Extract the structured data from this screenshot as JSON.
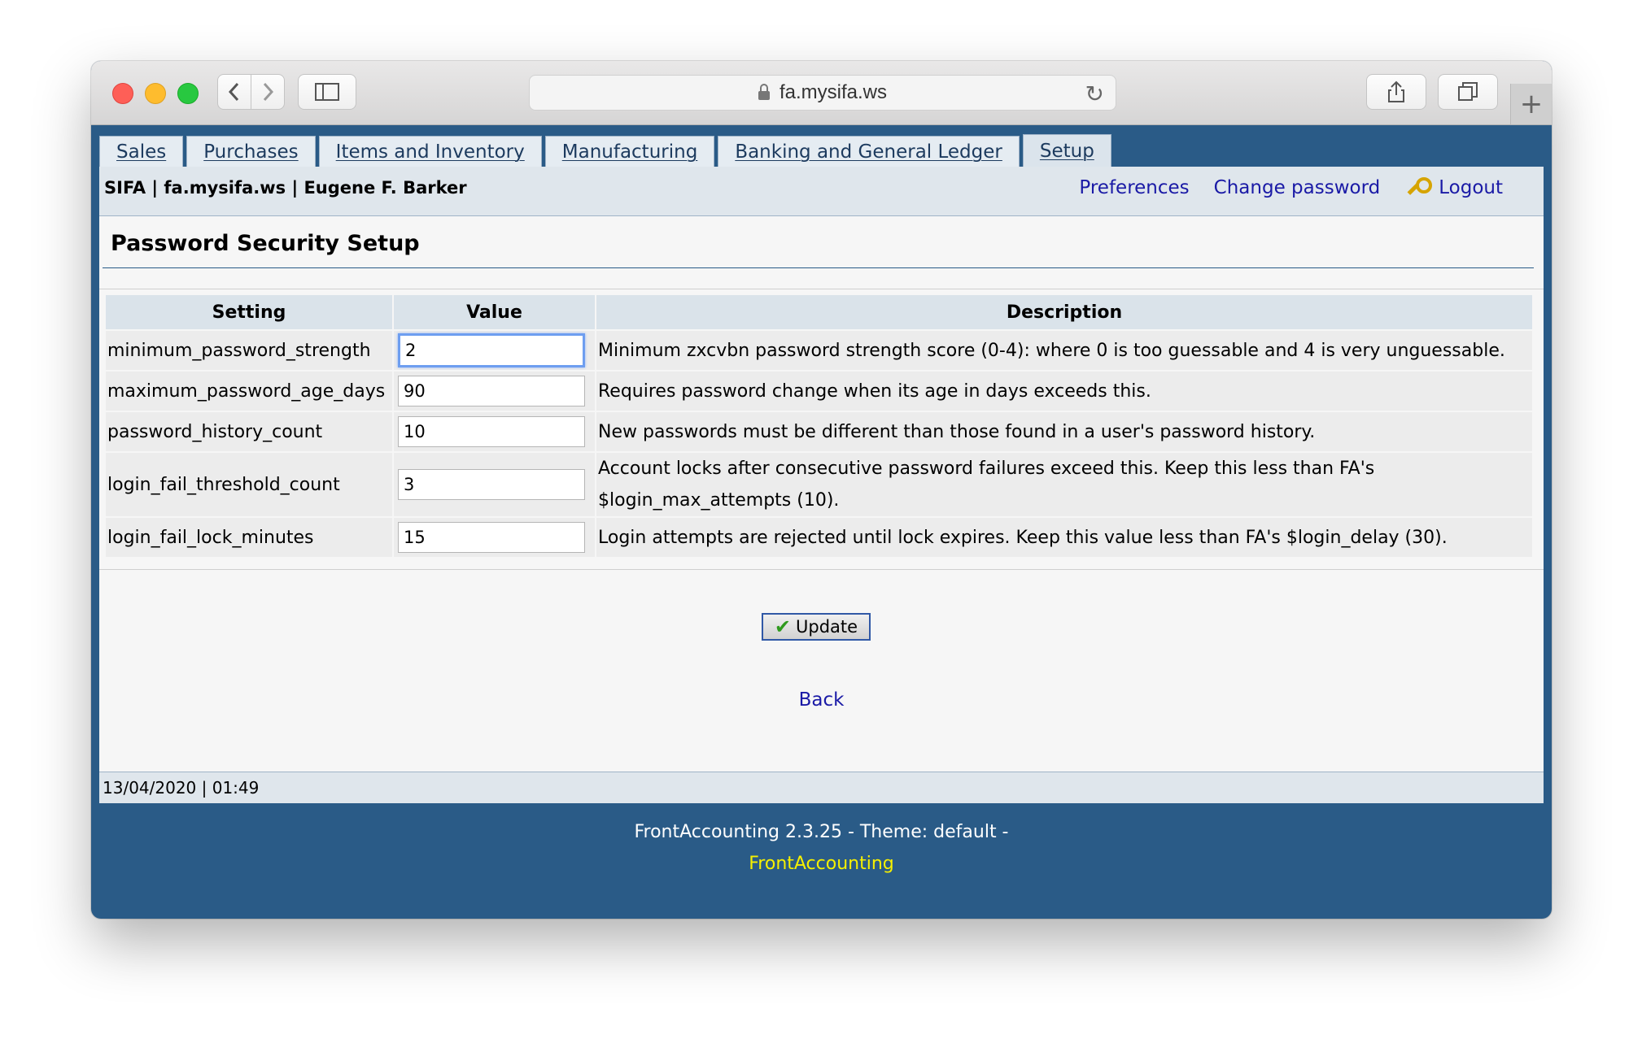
{
  "browser": {
    "url": "fa.mysifa.ws",
    "back_icon": "chevron-left-icon",
    "forward_icon": "chevron-right-icon",
    "sidebar_icon": "sidebar-icon",
    "share_icon": "share-icon",
    "tabs_icon": "tabs-icon",
    "new_tab_label": "+",
    "reload_label": "↻"
  },
  "nav": {
    "tabs": [
      {
        "label": "Sales",
        "active": false
      },
      {
        "label": "Purchases",
        "active": false
      },
      {
        "label": "Items and Inventory",
        "active": false
      },
      {
        "label": "Manufacturing",
        "active": false
      },
      {
        "label": "Banking and General Ledger",
        "active": false
      },
      {
        "label": "Setup",
        "active": true
      }
    ]
  },
  "header": {
    "company_line": "SIFA | fa.mysifa.ws | Eugene F. Barker",
    "preferences": "Preferences",
    "change_password": "Change password",
    "logout": "Logout"
  },
  "page": {
    "title": "Password Security Setup",
    "columns": [
      "Setting",
      "Value",
      "Description"
    ],
    "rows": [
      {
        "setting": "minimum_password_strength",
        "value": "2",
        "description": "Minimum zxcvbn password strength score (0-4): where 0 is too guessable and 4 is very unguessable."
      },
      {
        "setting": "maximum_password_age_days",
        "value": "90",
        "description": "Requires password change when its age in days exceeds this."
      },
      {
        "setting": "password_history_count",
        "value": "10",
        "description": "New passwords must be different than those found in a user's password history."
      },
      {
        "setting": "login_fail_threshold_count",
        "value": "3",
        "description": "Account locks after consecutive password failures exceed this. Keep this less than FA's $login_max_attempts (10)."
      },
      {
        "setting": "login_fail_lock_minutes",
        "value": "15",
        "description": "Login attempts are rejected until lock expires. Keep this value less than FA's $login_delay (30)."
      }
    ],
    "update_label": "Update",
    "back_label": "Back"
  },
  "status": {
    "datetime": "13/04/2020 | 01:49"
  },
  "footer": {
    "version": "FrontAccounting 2.3.25 - Theme: default -",
    "brand": "FrontAccounting"
  },
  "colors": {
    "frame": "#2a5b87",
    "link": "#1a1aa6",
    "brand": "#f6f000"
  }
}
